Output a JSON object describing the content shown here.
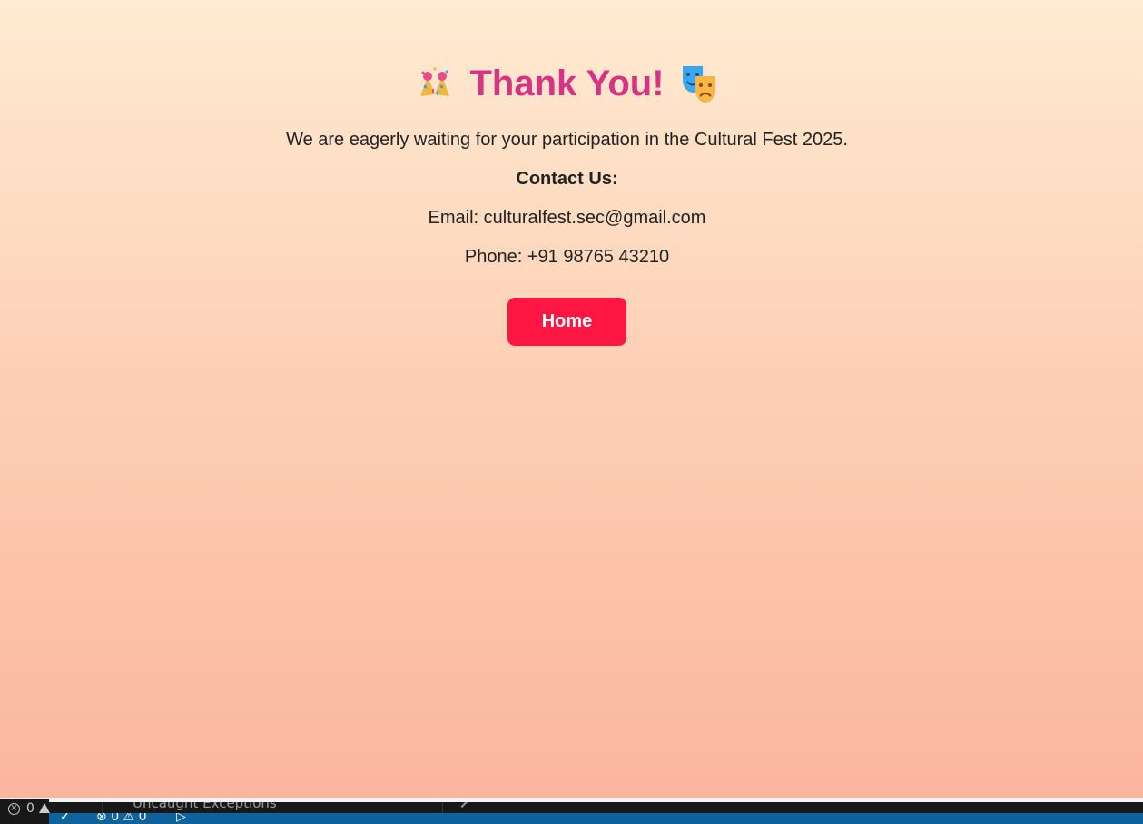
{
  "title": "Thank You!",
  "title_left_icon": "party-popper-icon",
  "title_right_icon": "performing-arts-masks-icon",
  "message": "We are eagerly waiting for your participation in the Cultural Fest 2025.",
  "contact_heading": "Contact Us:",
  "email_line": "Email: culturalfest.sec@gmail.com",
  "phone_line": "Phone: +91 98765 43210",
  "home_button_label": "Home",
  "colors": {
    "title": "#d63384",
    "button": "#ff1744",
    "background_top": "#ffebd2",
    "background_bottom": "#fbb59f",
    "statusbar": "#0e639c"
  },
  "ide": {
    "error_count": "0",
    "breakpoint_label": "Uncaught Exceptions",
    "status_errors": "0",
    "status_warnings": "0"
  }
}
